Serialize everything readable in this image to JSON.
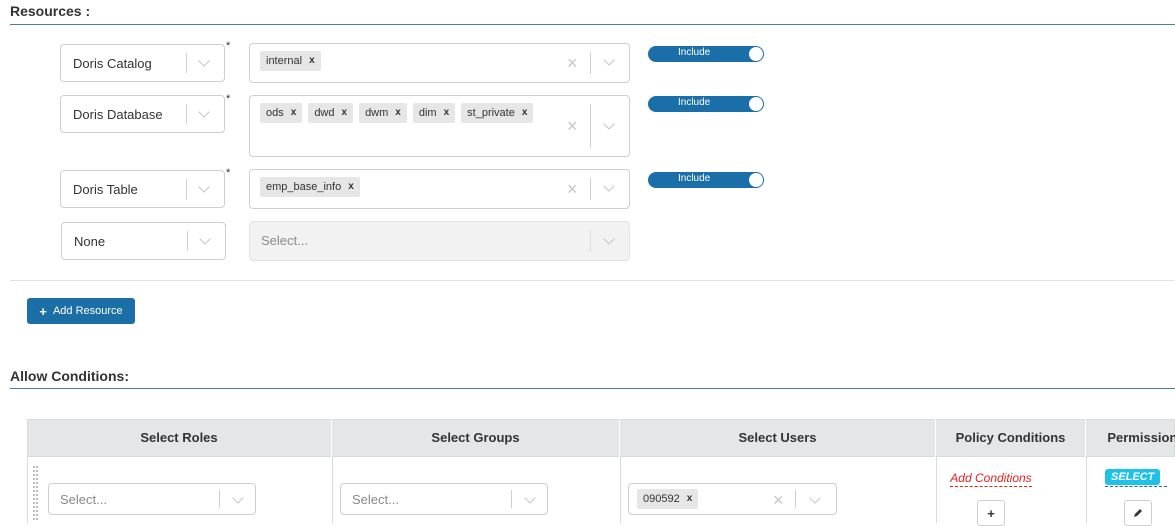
{
  "resources_section": {
    "title": "Resources :"
  },
  "resources": [
    {
      "type": "Doris Catalog",
      "required": "*",
      "values": [
        "internal"
      ],
      "toggle": "Include"
    },
    {
      "type": "Doris Database",
      "required": "*",
      "values": [
        "ods",
        "dwd",
        "dwm",
        "dim",
        "st_private"
      ],
      "toggle": "Include"
    },
    {
      "type": "Doris Table",
      "required": "*",
      "values": [
        "emp_base_info"
      ],
      "toggle": "Include"
    },
    {
      "type": "None",
      "placeholder": "Select..."
    }
  ],
  "add_resource_label": "Add Resource",
  "allow_section": {
    "title": "Allow Conditions:"
  },
  "conditions_table": {
    "headers": [
      "Select Roles",
      "Select Groups",
      "Select Users",
      "Policy Conditions",
      "Permissions"
    ],
    "row": {
      "roles_placeholder": "Select...",
      "groups_placeholder": "Select...",
      "users": [
        "090592"
      ],
      "add_conditions": "Add Conditions",
      "permission": "SELECT"
    }
  },
  "icons": {
    "remove": "x",
    "chevron": "chevron-down-icon",
    "plus": "+",
    "edit": "pencil-icon"
  },
  "colors": {
    "accent": "#1a6fa6",
    "toggle": "#1b6fa8",
    "badge": "#1ec1ea",
    "danger": "#e02424"
  }
}
